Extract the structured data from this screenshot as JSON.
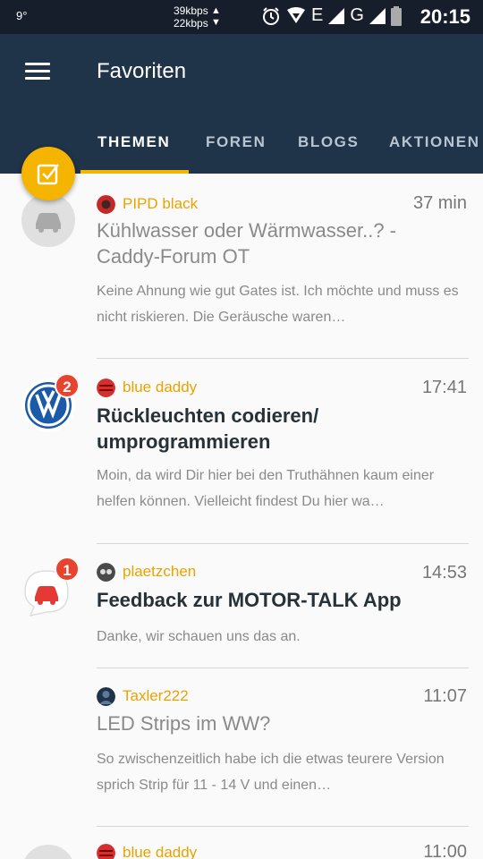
{
  "status_bar": {
    "temperature": "9°",
    "upload_speed": "39kbps",
    "download_speed": "22kbps",
    "network_label": "E",
    "network_label_2": "G",
    "time": "20:15"
  },
  "app_bar": {
    "title": "Favoriten",
    "menu_icon": "hamburger-menu-icon"
  },
  "tabs": [
    {
      "label": "THEMEN",
      "active": true
    },
    {
      "label": "FOREN",
      "active": false
    },
    {
      "label": "BLOGS",
      "active": false
    },
    {
      "label": "AKTIONEN",
      "active": false
    }
  ],
  "fab": {
    "icon": "checklist-icon",
    "color": "#f5b400"
  },
  "colors": {
    "app_bar": "#1f3349",
    "status_bar": "#151e2a",
    "accent": "#f5b400",
    "badge": "#e8432e",
    "author": "#e9a300"
  },
  "threads": [
    {
      "author": "PIPD black",
      "time": "37 min",
      "title": "Kühlwasser oder Wärmwasser..? - Caddy-Forum OT",
      "excerpt": "Keine Ahnung wie gut Gates ist. Ich möchte und muss es nicht riskieren. Die Geräusche waren…",
      "read": true,
      "avatar_icon": "car-icon",
      "badge": null
    },
    {
      "author": "blue daddy",
      "time": "17:41",
      "title": "Rückleuchten codieren/ umprogrammieren",
      "excerpt": "Moin, da wird Dir hier bei den Truthähnen kaum einer helfen können. Vielleicht findest Du hier wa…",
      "read": false,
      "avatar_icon": "vw-logo-icon",
      "badge": "2"
    },
    {
      "author": "plaetzchen",
      "time": "14:53",
      "title": "Feedback zur MOTOR-TALK App",
      "excerpt": "Danke, wir schauen uns das an.",
      "read": false,
      "avatar_icon": "chat-car-icon",
      "badge": "1"
    },
    {
      "author": "Taxler222",
      "time": "11:07",
      "title": "LED Strips im WW?",
      "excerpt": "So zwischenzeitlich habe ich die etwas teurere Version sprich Strip für 11 - 14 V und einen…",
      "read": true,
      "avatar_icon": null,
      "badge": null
    },
    {
      "author": "blue daddy",
      "time": "11:00",
      "title": "",
      "excerpt": "",
      "read": true,
      "avatar_icon": "car-icon",
      "badge": null
    }
  ]
}
